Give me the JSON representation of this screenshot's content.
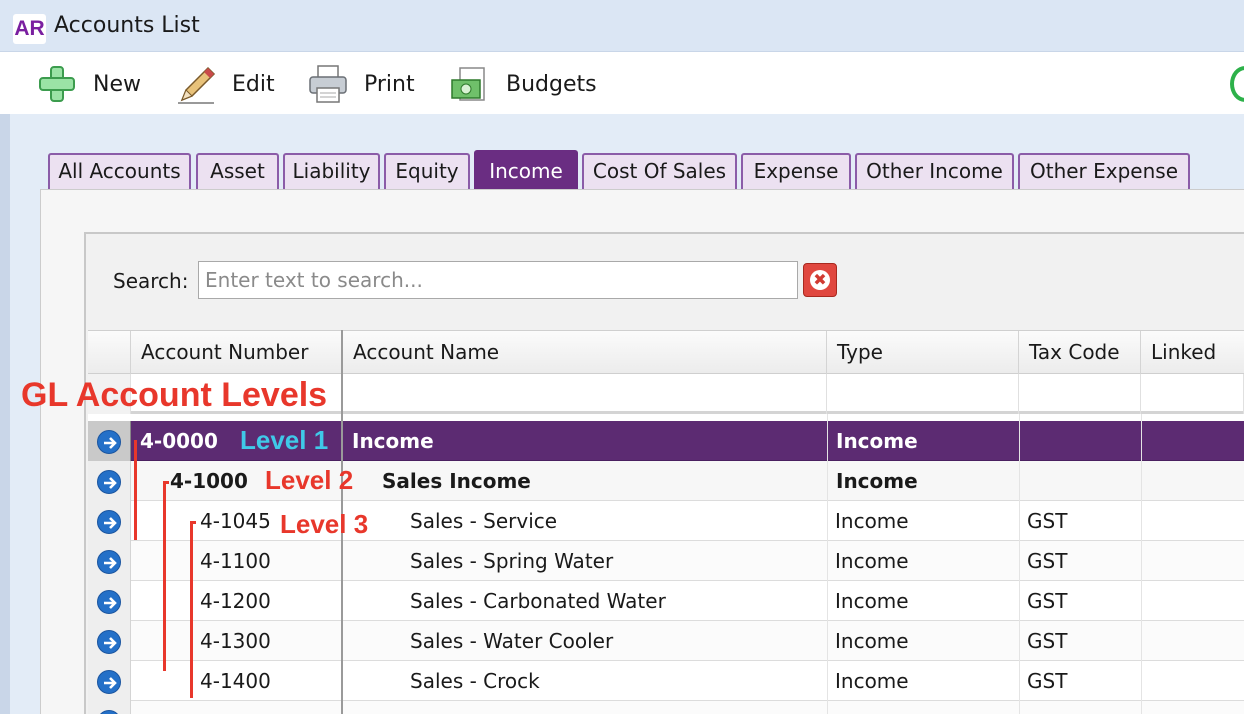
{
  "window": {
    "badge": "AR",
    "title": "Accounts List"
  },
  "toolbar": {
    "new_label": "New",
    "edit_label": "Edit",
    "print_label": "Print",
    "budgets_label": "Budgets"
  },
  "tabs": [
    {
      "label": "All Accounts",
      "active": false
    },
    {
      "label": "Asset",
      "active": false
    },
    {
      "label": "Liability",
      "active": false
    },
    {
      "label": "Equity",
      "active": false
    },
    {
      "label": "Income",
      "active": true
    },
    {
      "label": "Cost Of Sales",
      "active": false
    },
    {
      "label": "Expense",
      "active": false
    },
    {
      "label": "Other Income",
      "active": false
    },
    {
      "label": "Other Expense",
      "active": false
    }
  ],
  "search": {
    "label": "Search:",
    "placeholder": "Enter text to search...",
    "clear_glyph": "✖"
  },
  "grid": {
    "columns": {
      "account_number": "Account Number",
      "account_name": "Account Name",
      "type": "Type",
      "tax_code": "Tax Code",
      "linked": "Linked"
    },
    "rows": [
      {
        "number": "4-0000",
        "name": "Income",
        "type": "Income",
        "tax": "",
        "level": 1
      },
      {
        "number": "4-1000",
        "name": "Sales Income",
        "type": "Income",
        "tax": "",
        "level": 2
      },
      {
        "number": "4-1045",
        "name": "Sales - Service",
        "type": "Income",
        "tax": "GST",
        "level": 3
      },
      {
        "number": "4-1100",
        "name": "Sales - Spring Water",
        "type": "Income",
        "tax": "GST",
        "level": 3
      },
      {
        "number": "4-1200",
        "name": "Sales - Carbonated Water",
        "type": "Income",
        "tax": "GST",
        "level": 3
      },
      {
        "number": "4-1300",
        "name": "Sales - Water Cooler",
        "type": "Income",
        "tax": "GST",
        "level": 3
      },
      {
        "number": "4-1400",
        "name": "Sales - Crock",
        "type": "Income",
        "tax": "GST",
        "level": 3
      }
    ]
  },
  "annotations": {
    "title": "GL Account Levels",
    "level1": "Level 1",
    "level2": "Level 2",
    "level3": "Level 3"
  },
  "colors": {
    "accent": "#5c2b72",
    "annotation": "#e8372b",
    "level1_annotation": "#3fc9e8",
    "row_arrow": "#2470c8"
  },
  "icons": {
    "new": "plus-icon",
    "edit": "pencil-icon",
    "print": "printer-icon",
    "budgets": "money-icon",
    "row": "arrow-right-circle-icon",
    "clear": "close-icon"
  }
}
